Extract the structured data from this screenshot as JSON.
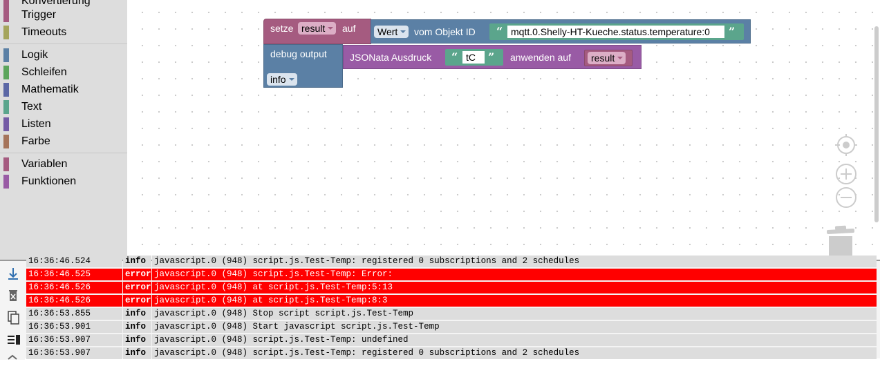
{
  "toolbox": {
    "categories": [
      {
        "label": "Konvertierung",
        "color": "#a55b80"
      },
      {
        "label": "Trigger",
        "color": "#a55b80"
      },
      {
        "label": "Timeouts",
        "color": "#a5a55b"
      },
      {
        "label": "Logik",
        "color": "#5b80a5"
      },
      {
        "label": "Schleifen",
        "color": "#5ba55b"
      },
      {
        "label": "Mathematik",
        "color": "#5b67a5"
      },
      {
        "label": "Text",
        "color": "#5ba58c"
      },
      {
        "label": "Listen",
        "color": "#745ba5"
      },
      {
        "label": "Farbe",
        "color": "#a5745b"
      },
      {
        "label": "Variablen",
        "color": "#a55b80"
      },
      {
        "label": "Funktionen",
        "color": "#995ba5"
      }
    ]
  },
  "blocks": {
    "set_var": {
      "label_setze": "setze",
      "var": "result",
      "label_auf": "auf",
      "color": "#a55b80"
    },
    "get_value": {
      "attr": "Wert",
      "label": "vom Objekt ID",
      "object_id": "mqtt.0.Shelly-HT-Kueche.status.temperature:0",
      "color": "#5b80a5"
    },
    "debug": {
      "label": "debug output",
      "level": "info",
      "color": "#5b80a5"
    },
    "jsonata": {
      "label": "JSONata Ausdruck",
      "expression": "tC",
      "label_apply": "anwenden auf",
      "var": "result",
      "color": "#995ba5"
    },
    "text_color": "#5ba58c",
    "quote_open": "“",
    "quote_close": "”"
  },
  "log": {
    "rows": [
      {
        "time": "16:36:46.524",
        "severity": "info",
        "message": "javascript.0 (948) script.js.Test-Temp: registered 0 subscriptions and 2 schedules",
        "error": false
      },
      {
        "time": "16:36:46.525",
        "severity": "error",
        "message": "javascript.0 (948) script.js.Test-Temp: Error:",
        "error": true
      },
      {
        "time": "16:36:46.526",
        "severity": "error",
        "message": "javascript.0 (948) at script.js.Test-Temp:5:13",
        "error": true
      },
      {
        "time": "16:36:46.526",
        "severity": "error",
        "message": "javascript.0 (948) at script.js.Test-Temp:8:3",
        "error": true
      },
      {
        "time": "16:36:53.855",
        "severity": "info",
        "message": "javascript.0 (948) Stop script script.js.Test-Temp",
        "error": false
      },
      {
        "time": "16:36:53.901",
        "severity": "info",
        "message": "javascript.0 (948) Start javascript script.js.Test-Temp",
        "error": false
      },
      {
        "time": "16:36:53.907",
        "severity": "info",
        "message": "javascript.0 (948) script.js.Test-Temp: undefined",
        "error": false
      },
      {
        "time": "16:36:53.907",
        "severity": "info",
        "message": "javascript.0 (948) script.js.Test-Temp: registered 0 subscriptions and 2 schedules",
        "error": false
      }
    ],
    "tools": [
      "scroll-down-icon",
      "delete-icon",
      "copy-icon",
      "list-icon",
      "more-icon"
    ]
  }
}
